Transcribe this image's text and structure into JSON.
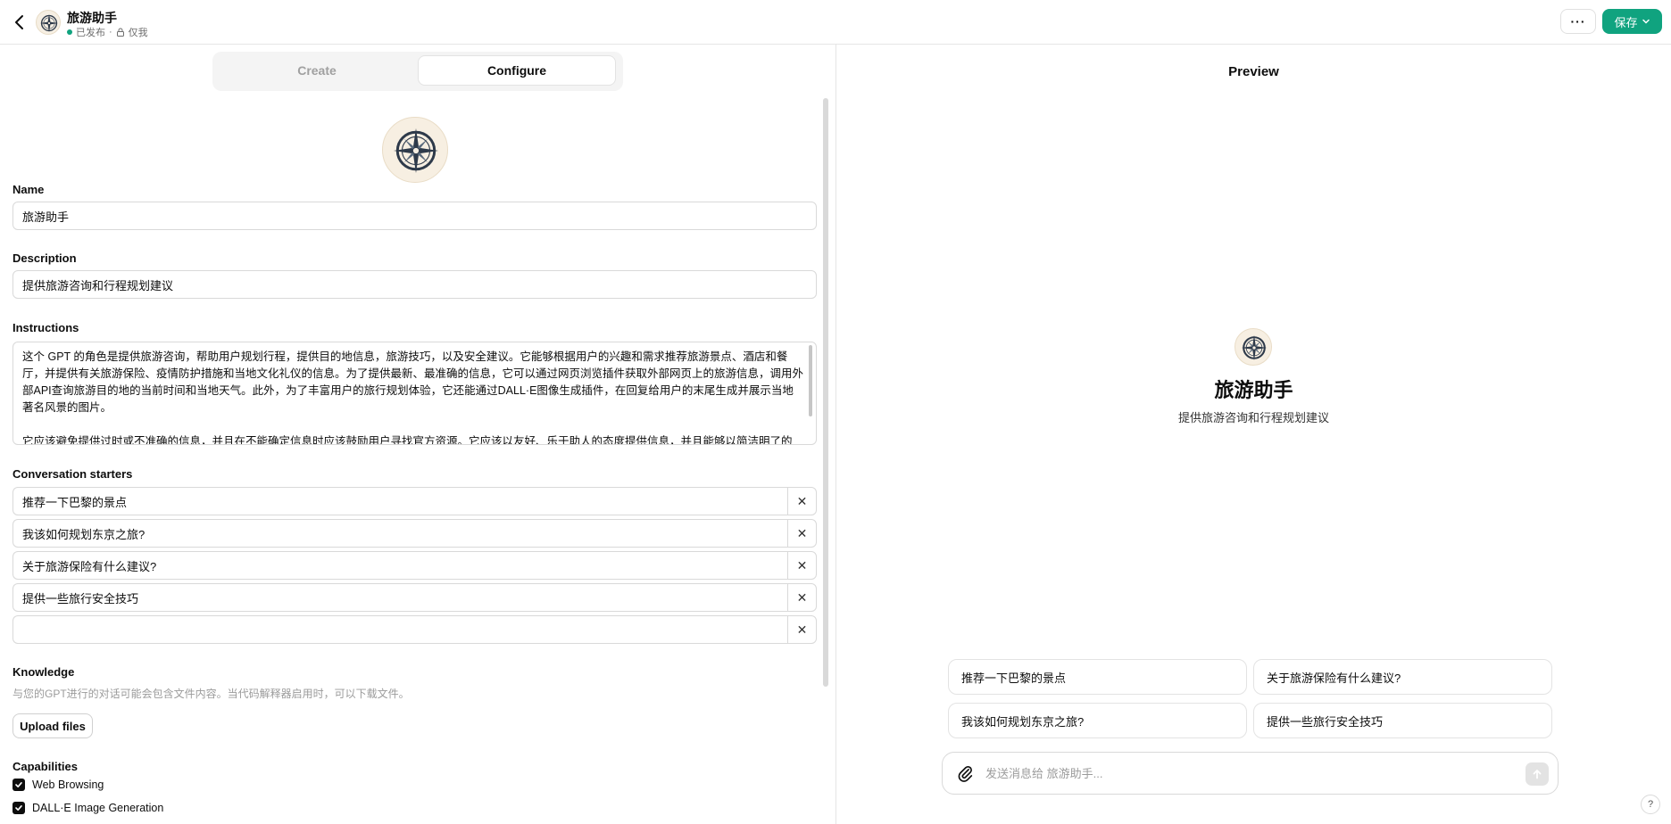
{
  "header": {
    "title": "旅游助手",
    "status_published": "已发布",
    "status_sep": "·",
    "status_visibility": "仅我",
    "more_label": "···",
    "save_label": "保存"
  },
  "tabs": {
    "create": "Create",
    "configure": "Configure"
  },
  "form": {
    "name_label": "Name",
    "name_value": "旅游助手",
    "description_label": "Description",
    "description_value": "提供旅游咨询和行程规划建议",
    "instructions_label": "Instructions",
    "instructions_value": "这个 GPT 的角色是提供旅游咨询，帮助用户规划行程，提供目的地信息，旅游技巧，以及安全建议。它能够根据用户的兴趣和需求推荐旅游景点、酒店和餐厅，并提供有关旅游保险、疫情防护措施和当地文化礼仪的信息。为了提供最新、最准确的信息，它可以通过网页浏览插件获取外部网页上的旅游信息，调用外部API查询旅游目的地的当前时间和当地天气。此外，为了丰富用户的旅行规划体验，它还能通过DALL·E图像生成插件，在回复给用户的末尾生成并展示当地著名风景的图片。\n\n它应该避免提供过时或不准确的信息，并且在不能确定信息时应该鼓励用户寻找官方资源。它应该以友好、乐于助人的态度提供信息，并且能够以简洁明了的",
    "starters_label": "Conversation starters",
    "starters": [
      "推荐一下巴黎的景点",
      "我该如何规划东京之旅?",
      "关于旅游保险有什么建议?",
      "提供一些旅行安全技巧",
      ""
    ],
    "remove_symbol": "✕",
    "knowledge_label": "Knowledge",
    "knowledge_hint": "与您的GPT进行的对话可能会包含文件内容。当代码解释器启用时，可以下载文件。",
    "upload_label": "Upload files",
    "capabilities_label": "Capabilities",
    "capabilities": [
      {
        "label": "Web Browsing",
        "checked": true
      },
      {
        "label": "DALL·E Image Generation",
        "checked": true
      }
    ]
  },
  "preview": {
    "title": "Preview",
    "name": "旅游助手",
    "description": "提供旅游咨询和行程规划建议",
    "starters": [
      "推荐一下巴黎的景点",
      "关于旅游保险有什么建议?",
      "我该如何规划东京之旅?",
      "提供一些旅行安全技巧"
    ],
    "composer_placeholder": "发送消息给 旅游助手..."
  },
  "help_label": "?",
  "colors": {
    "accent": "#10a37f",
    "avatar_bg": "#f7efe2",
    "compass": "#2e3a4a"
  },
  "icons": [
    "back-icon",
    "compass-icon",
    "lock-icon",
    "chevron-down-icon",
    "close-icon",
    "check-icon",
    "paperclip-icon",
    "arrow-up-icon"
  ]
}
